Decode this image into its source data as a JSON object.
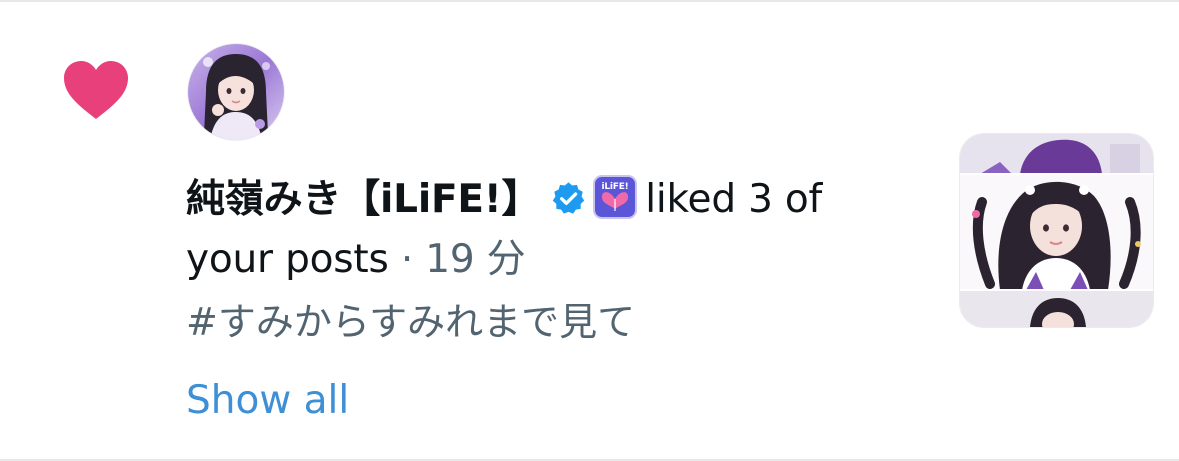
{
  "notification": {
    "type_icon": "heart-icon",
    "user": {
      "display_name": "純嶺みき【iLiFE!】",
      "verified_icon": "verified-badge-icon",
      "affiliate_badge": "ilife-badge-icon",
      "affiliate_badge_text": "iLiFE!"
    },
    "action": "liked 3 of your posts",
    "separator": "·",
    "time_ago": "19 分",
    "post_excerpt": "#すみからすみれまで見て",
    "show_all_label": "Show all"
  },
  "colors": {
    "heart": "#e8407a",
    "verified": "#1d9bf0",
    "link": "#3d8fd6",
    "secondary_text": "#536471",
    "primary_text": "#0f1419",
    "divider": "#e8e8e8"
  }
}
